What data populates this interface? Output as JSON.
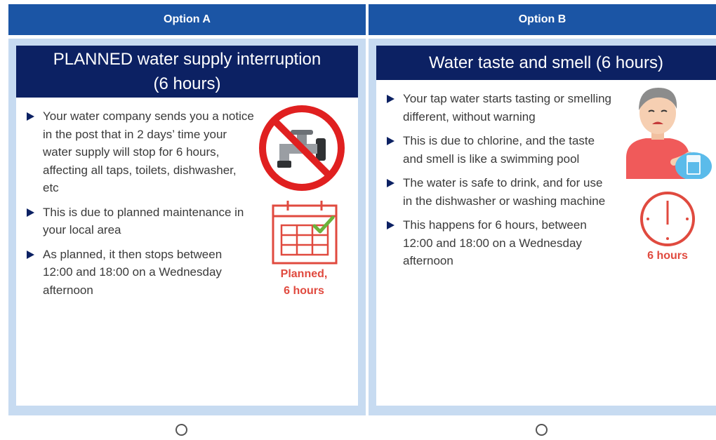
{
  "options": [
    {
      "header": "Option A",
      "title_emphasis": "PLANNED",
      "title_rest": " water supply interruption",
      "title_line2": "(6 hours)",
      "bullets": [
        "Your water company sends you a notice in the post that in 2 days’ time your water supply will stop for 6 hours, affecting all taps, toilets, dishwasher, etc",
        "This is due to planned maintenance in your local area",
        "As planned, it then stops between 12:00 and 18:00 on a Wednesday afternoon"
      ],
      "icon_label_line1": "Planned,",
      "icon_label_line2": "6 hours",
      "icons": [
        "no-water-tap-icon",
        "calendar-check-icon"
      ]
    },
    {
      "header": "Option B",
      "title": "Water taste and smell (6 hours)",
      "bullets": [
        "Your tap water starts tasting or smelling different, without warning",
        "This is due to chlorine, and the taste and smell is like a swimming pool",
        "The water is safe to drink, and for use in the dishwasher or washing machine",
        "This happens for 6 hours, between 12:00 and 18:00 on a Wednesday afternoon"
      ],
      "icon_label": "6 hours",
      "icons": [
        "sad-person-with-water-glass-icon",
        "clock-icon"
      ]
    }
  ],
  "colors": {
    "header_bg": "#1b55a5",
    "panel_bg": "#c7dbf1",
    "title_bg": "#0c2163",
    "accent_red": "#e04a3f"
  }
}
